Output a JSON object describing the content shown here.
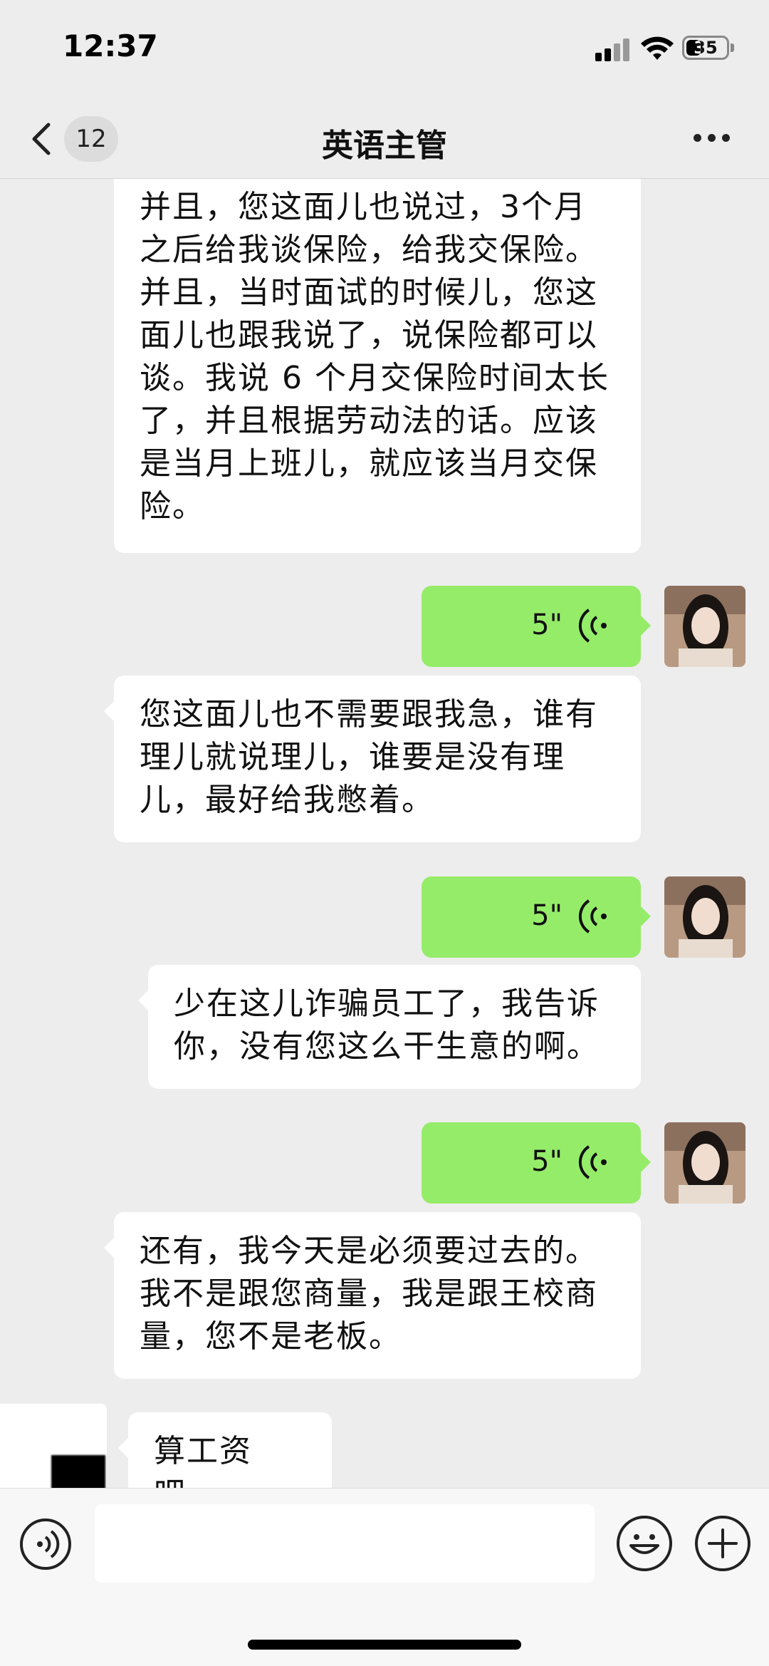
{
  "status_bar": {
    "time": "12:37",
    "battery": "35"
  },
  "nav": {
    "unread_count": "12",
    "title": "英语主管"
  },
  "messages": [
    {
      "side": "left",
      "type": "text",
      "lines": [
        "并且，您这面儿也说过，3个月",
        "之后给我谈保险，给我交保险。",
        "并且，当时面试的时候儿，您这",
        "面儿也跟我说了，说保险都可以",
        "谈。我说 6 个月交保险时间太长",
        "了，并且根据劳动法的话。应该",
        "是当月上班儿，就应该当月交保",
        "险。"
      ]
    },
    {
      "side": "right",
      "type": "voice",
      "duration": "5\""
    },
    {
      "side": "left",
      "type": "text",
      "lines": [
        "您这面儿也不需要跟我急，谁有",
        "理儿就说理儿，谁要是没有理",
        "儿，最好给我憋着。"
      ]
    },
    {
      "side": "right",
      "type": "voice",
      "duration": "5\""
    },
    {
      "side": "left",
      "type": "text",
      "lines": [
        "少在这儿诈骗员工了，我告诉",
        "你，没有您这么干生意的啊。"
      ]
    },
    {
      "side": "right",
      "type": "voice",
      "duration": "5\""
    },
    {
      "side": "left",
      "type": "text",
      "lines": [
        "还有，我今天是必须要过去的。",
        "我不是跟您商量，我是跟王校商",
        "量，您不是老板。"
      ]
    },
    {
      "side": "left",
      "type": "text",
      "lines": [
        "算工资吧。"
      ]
    }
  ],
  "input": {
    "value": ""
  },
  "colors": {
    "background": "#ededed",
    "outgoing_bubble": "#95ec69",
    "incoming_bubble": "#ffffff"
  },
  "icons": [
    "back-icon",
    "more-icon",
    "voice-wave-icon",
    "voice-input-icon",
    "emoji-icon",
    "plus-icon"
  ]
}
